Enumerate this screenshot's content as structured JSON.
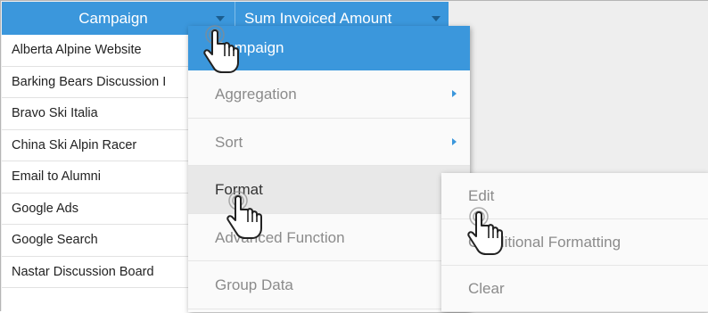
{
  "table": {
    "headers": [
      {
        "label": "Campaign"
      },
      {
        "label": "Sum Invoiced Amount"
      }
    ],
    "rows": [
      "Alberta Alpine Website",
      "Barking Bears Discussion I",
      "Bravo Ski Italia",
      "China Ski Alpin Racer",
      "Email to Alumni",
      "Google Ads",
      "Google Search",
      "Nastar Discussion Board"
    ]
  },
  "column_menu": {
    "title": "Campaign",
    "items": [
      {
        "label": "Aggregation",
        "has_submenu": true
      },
      {
        "label": "Sort",
        "has_submenu": true
      },
      {
        "label": "Format",
        "has_submenu": false,
        "active": true
      },
      {
        "label": "Advanced Function",
        "has_submenu": false
      },
      {
        "label": "Group Data",
        "has_submenu": false
      }
    ]
  },
  "format_submenu": {
    "items": [
      {
        "label": "Edit"
      },
      {
        "label": "Conditional Formatting"
      },
      {
        "label": "Clear"
      }
    ]
  },
  "colors": {
    "accent": "#3b97dc",
    "menu_bg": "#fafafa",
    "active_item_bg": "#e8e8e8",
    "canvas_bg": "#eeeeee"
  },
  "icons": {
    "header_dropdown": "caret-down-icon",
    "submenu": "caret-right-icon",
    "cursor": "hand-pointer-icon"
  }
}
